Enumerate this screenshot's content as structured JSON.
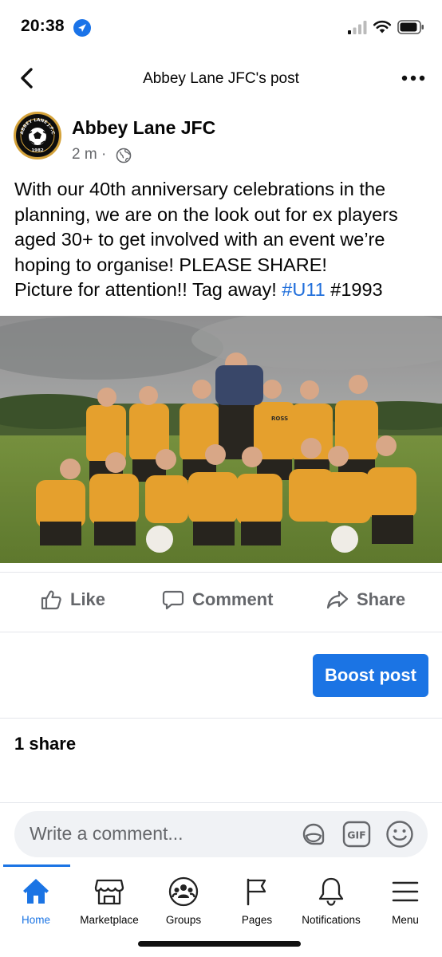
{
  "status_bar": {
    "time": "20:38"
  },
  "header": {
    "title": "Abbey Lane JFC's post"
  },
  "post": {
    "author": "Abbey Lane JFC",
    "time": "2 m ·",
    "text_lines": [
      "With our 40th anniversary celebrations in the",
      "planning, we are on the look out for ex players",
      "aged 30+ to get involved with an event we’re",
      "hoping to organise! PLEASE SHARE!",
      "Picture for attention!! Tag away! "
    ],
    "hashtag_1": "#U11",
    "hashtag_2": "#1993",
    "avatar": {
      "top_text": "ABBEY LANE J.F.C",
      "year": "1982"
    },
    "photo_shirt_text": "ROSS"
  },
  "actions": {
    "like": "Like",
    "comment": "Comment",
    "share": "Share"
  },
  "boost_label": "Boost post",
  "shares_count": "1 share",
  "comment": {
    "placeholder": "Write a comment...",
    "gif_label": "GIF"
  },
  "nav": {
    "items": [
      {
        "label": "Home"
      },
      {
        "label": "Marketplace"
      },
      {
        "label": "Groups"
      },
      {
        "label": "Pages"
      },
      {
        "label": "Notifications"
      },
      {
        "label": "Menu"
      }
    ]
  },
  "colors": {
    "accent": "#1b74e4",
    "hashtag": "#216fdb",
    "secondary_text": "#65676b",
    "shirt": "#e8a02a"
  },
  "icons": [
    "location-arrow-icon",
    "signal-icon",
    "wifi-icon",
    "battery-icon",
    "back-icon",
    "more-icon",
    "globe-icon",
    "like-icon",
    "comment-icon",
    "share-icon",
    "sticker-icon",
    "gif-icon",
    "emoji-icon",
    "home-icon",
    "marketplace-icon",
    "groups-icon",
    "pages-icon",
    "notifications-icon",
    "menu-icon"
  ]
}
